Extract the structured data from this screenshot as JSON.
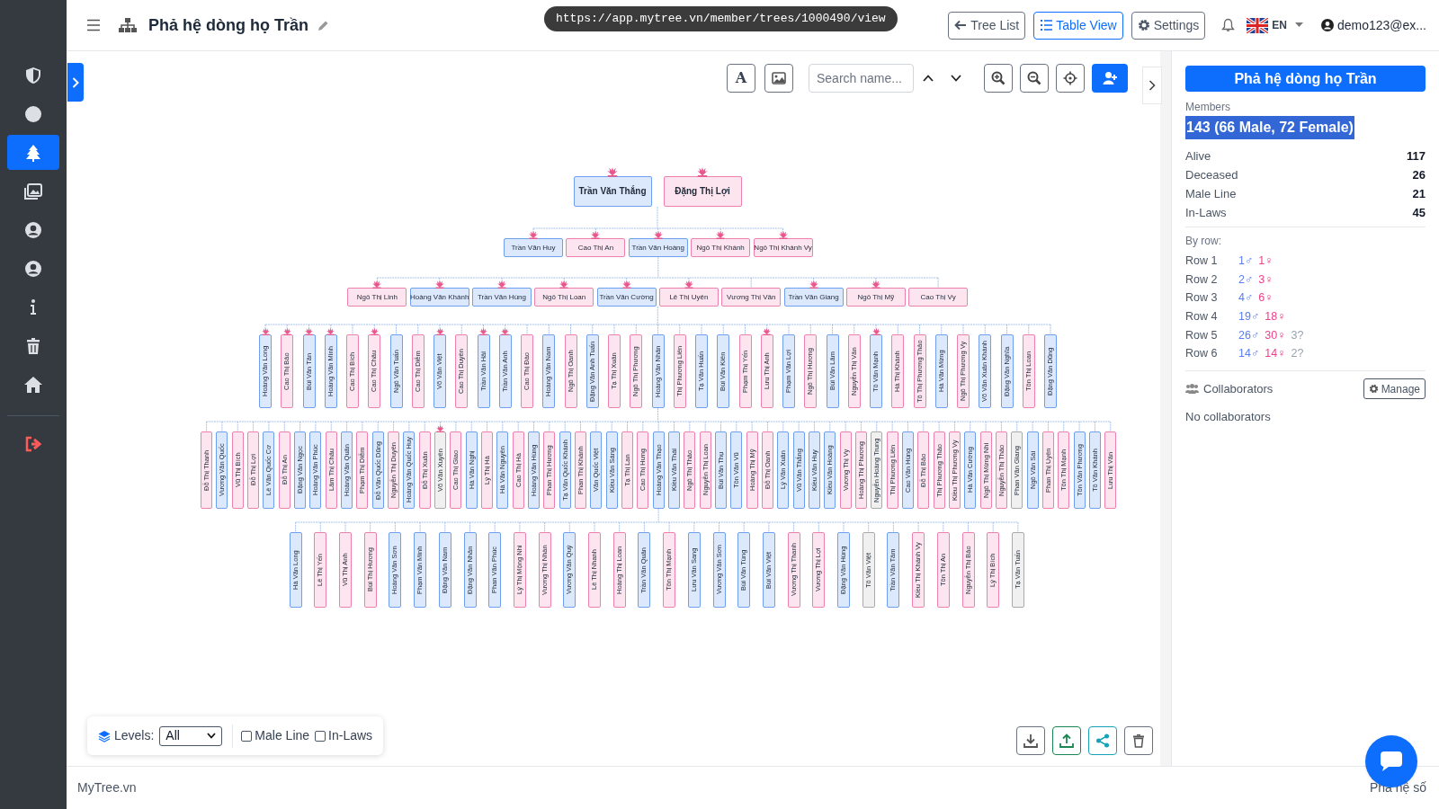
{
  "header": {
    "title": "Phả hệ dòng họ Trần",
    "url": "https://app.mytree.vn/member/trees/1000490/view",
    "buttons": [
      {
        "label": "Tree List",
        "selected": false
      },
      {
        "label": "Table View",
        "selected": true
      },
      {
        "label": "Settings",
        "selected": false
      }
    ],
    "language": "EN",
    "user": "demo123@ex..."
  },
  "sidebar": {
    "items": [
      {
        "selected": false
      },
      {
        "selected": false
      },
      {
        "selected": true
      },
      {
        "selected": false
      },
      {
        "selected": false
      },
      {
        "selected": false
      },
      {
        "selected": false
      },
      {
        "selected": false
      },
      {
        "selected": false
      },
      {
        "selected": false
      }
    ]
  },
  "canvas_toolbar": {
    "text_button": "A",
    "search": {
      "placeholder": "Search name..."
    }
  },
  "tree": {
    "rows": [
      {
        "nodes": [
          {
            "name": "Trần Văn Thắng",
            "kind": "male",
            "crowned": true
          },
          {
            "name": "Đặng Thị Lợi",
            "kind": "female",
            "crowned": true
          }
        ]
      },
      {
        "nodes": [
          {
            "name": "Trần Văn Huy",
            "kind": "male",
            "crowned": true
          },
          {
            "name": "Cao Thị An",
            "kind": "female",
            "crowned": true
          },
          {
            "name": "Trần Văn Hoàng",
            "kind": "male",
            "crowned": true
          },
          {
            "name": "Ngô Thị Khánh",
            "kind": "female",
            "crowned": true
          },
          {
            "name": "Ngô Thị Khánh Vy",
            "kind": "female",
            "crowned": true
          }
        ]
      },
      {
        "nodes": [
          {
            "name": "Ngô Thị Linh",
            "kind": "female",
            "crowned": true
          },
          {
            "name": "Hoàng Văn Khánh",
            "kind": "male",
            "crowned": true
          },
          {
            "name": "Trần Văn Hùng",
            "kind": "male",
            "crowned": true
          },
          {
            "name": "Ngô Thị Loan",
            "kind": "female",
            "crowned": true
          },
          {
            "name": "Trần Văn Cường",
            "kind": "male",
            "crowned": true
          },
          {
            "name": "Lê Thị Uyên",
            "kind": "female",
            "crowned": true
          },
          {
            "name": "Vương Thị Vân",
            "kind": "female",
            "crowned": false
          },
          {
            "name": "Trần Văn Giang",
            "kind": "male",
            "crowned": true
          },
          {
            "name": "Ngô Thị Mỹ",
            "kind": "female",
            "crowned": true
          },
          {
            "name": "Cao Thị Vy",
            "kind": "female",
            "crowned": false
          }
        ]
      },
      {
        "nodes": [
          {
            "name": "Hoàng Văn Long",
            "kind": "male",
            "crowned": true
          },
          {
            "name": "Cao Thị Bảo",
            "kind": "female",
            "crowned": true
          },
          {
            "name": "Bùi Văn Tân",
            "kind": "male",
            "crowned": true
          },
          {
            "name": "Hoàng Văn Minh",
            "kind": "male",
            "crowned": true
          },
          {
            "name": "Cao Thị Bích",
            "kind": "female",
            "crowned": false
          },
          {
            "name": "Cao Thị Châu",
            "kind": "female",
            "crowned": true
          },
          {
            "name": "Ngô Văn Tuấn",
            "kind": "male",
            "crowned": false
          },
          {
            "name": "Cao Thị Diễm",
            "kind": "female",
            "crowned": false
          },
          {
            "name": "Võ Văn Việt",
            "kind": "male",
            "crowned": true
          },
          {
            "name": "Cao Thị Duyên",
            "kind": "female",
            "crowned": false
          },
          {
            "name": "Trần Văn Hải",
            "kind": "male",
            "crowned": true
          },
          {
            "name": "Trần Văn Anh",
            "kind": "male",
            "crowned": true
          },
          {
            "name": "Cao Thị Đào",
            "kind": "female",
            "crowned": false
          },
          {
            "name": "Hoàng Văn Nam",
            "kind": "male",
            "crowned": false
          },
          {
            "name": "Ngô Thị Oanh",
            "kind": "female",
            "crowned": false
          },
          {
            "name": "Đặng Văn Anh Tuấn",
            "kind": "male",
            "crowned": false
          },
          {
            "name": "Tạ Thị Xuân",
            "kind": "female",
            "crowned": false
          },
          {
            "name": "Ngô Thị Phương",
            "kind": "female",
            "crowned": false
          },
          {
            "name": "Hoàng Văn Nhân",
            "kind": "male",
            "crowned": false
          },
          {
            "name": "Thị Phương Liên",
            "kind": "female",
            "crowned": false
          },
          {
            "name": "Tạ Văn Huấn",
            "kind": "male",
            "crowned": false
          },
          {
            "name": "Bùi Văn Kiên",
            "kind": "male",
            "crowned": false
          },
          {
            "name": "Phạm Thị Yến",
            "kind": "female",
            "crowned": false
          },
          {
            "name": "Lưu Thị Anh",
            "kind": "female",
            "crowned": true
          },
          {
            "name": "Phạm Văn Lợi",
            "kind": "male",
            "crowned": false
          },
          {
            "name": "Ngô Thị Hương",
            "kind": "female",
            "crowned": false
          },
          {
            "name": "Bùi Văn Lâm",
            "kind": "male",
            "crowned": false
          },
          {
            "name": "Nguyễn Thị Vân",
            "kind": "female",
            "crowned": false
          },
          {
            "name": "Tô Văn Mạnh",
            "kind": "male",
            "crowned": true
          },
          {
            "name": "Hà Thị Khánh",
            "kind": "female",
            "crowned": false
          },
          {
            "name": "Tô Thị Phương Thảo",
            "kind": "female",
            "crowned": false
          },
          {
            "name": "Hà Văn Mừng",
            "kind": "male",
            "crowned": false
          },
          {
            "name": "Ngô Thị Phương Vy",
            "kind": "female",
            "crowned": false
          },
          {
            "name": "Võ Văn Xuân Khánh",
            "kind": "male",
            "crowned": false
          },
          {
            "name": "Đặng Văn Nghĩa",
            "kind": "male",
            "crowned": false
          },
          {
            "name": "Tôn Thị Loan",
            "kind": "female",
            "crowned": false
          },
          {
            "name": "Đặng Văn Dũng",
            "kind": "male",
            "crowned": false
          }
        ]
      },
      {
        "nodes": [
          {
            "name": "Đỗ Thị Thanh",
            "kind": "female",
            "crowned": false
          },
          {
            "name": "Vương Văn Quốc",
            "kind": "male",
            "crowned": false
          },
          {
            "name": "Vũ Thị Bích",
            "kind": "female",
            "crowned": false
          },
          {
            "name": "Đỗ Thị Lợi",
            "kind": "female",
            "crowned": false
          },
          {
            "name": "Lê Văn Quốc Cơ",
            "kind": "male",
            "crowned": false
          },
          {
            "name": "Đỗ Thị An",
            "kind": "female",
            "crowned": false
          },
          {
            "name": "Đặng Văn Ngọc",
            "kind": "male",
            "crowned": false
          },
          {
            "name": "Hoàng Văn Phúc",
            "kind": "male",
            "crowned": false
          },
          {
            "name": "Lâm Thị Châu",
            "kind": "female",
            "crowned": false
          },
          {
            "name": "Hoàng Văn Quân",
            "kind": "male",
            "crowned": false
          },
          {
            "name": "Phạm Thị Diễm",
            "kind": "female",
            "crowned": false
          },
          {
            "name": "Đỗ Văn Quốc Dũng",
            "kind": "male",
            "crowned": false
          },
          {
            "name": "Nguyễn Thị Duyên",
            "kind": "female",
            "crowned": false
          },
          {
            "name": "Hoàng Văn Quốc Huy",
            "kind": "male",
            "crowned": false
          },
          {
            "name": "Đỗ Thị Xuân",
            "kind": "female",
            "crowned": false
          },
          {
            "name": "Võ Văn Xuyên",
            "kind": "unknown",
            "crowned": true
          },
          {
            "name": "Cao Thị Giao",
            "kind": "female",
            "crowned": false
          },
          {
            "name": "Hà Văn Nghị",
            "kind": "male",
            "crowned": false
          },
          {
            "name": "Lý Thị Hà",
            "kind": "female",
            "crowned": false
          },
          {
            "name": "Hà Văn Nguyên",
            "kind": "male",
            "crowned": false
          },
          {
            "name": "Cao Thị Hà",
            "kind": "female",
            "crowned": false
          },
          {
            "name": "Hoàng Văn Hùng",
            "kind": "male",
            "crowned": false
          },
          {
            "name": "Phan Thị Hương",
            "kind": "female",
            "crowned": false
          },
          {
            "name": "Tạ Văn Quốc Khánh",
            "kind": "male",
            "crowned": false
          },
          {
            "name": "Phan Thị Khánh",
            "kind": "female",
            "crowned": false
          },
          {
            "name": "Văn Quốc Việt",
            "kind": "male",
            "crowned": false
          },
          {
            "name": "Kiều Văn Sáng",
            "kind": "male",
            "crowned": false
          },
          {
            "name": "Tạ Thị Lan",
            "kind": "female",
            "crowned": false
          },
          {
            "name": "Cao Thị Hưng",
            "kind": "female",
            "crowned": false
          },
          {
            "name": "Hoàng Văn Thạo",
            "kind": "male",
            "crowned": false
          },
          {
            "name": "Kiều Văn Thái",
            "kind": "male",
            "crowned": false
          },
          {
            "name": "Ngô Thị Thảo",
            "kind": "female",
            "crowned": false
          },
          {
            "name": "Nguyễn Thị Loan",
            "kind": "female",
            "crowned": false
          },
          {
            "name": "Bùi Văn Thụ",
            "kind": "male",
            "crowned": false
          },
          {
            "name": "Tôn Văn Vũ",
            "kind": "male",
            "crowned": false
          },
          {
            "name": "Hoàng Thị Mỹ",
            "kind": "female",
            "crowned": false
          },
          {
            "name": "Đỗ Thị Oanh",
            "kind": "female",
            "crowned": false
          },
          {
            "name": "Lý Văn Xuân",
            "kind": "male",
            "crowned": false
          },
          {
            "name": "Vũ Văn Thắng",
            "kind": "male",
            "crowned": false
          },
          {
            "name": "Kiều Văn Huy",
            "kind": "male",
            "crowned": false
          },
          {
            "name": "Kiều Văn Hoàng",
            "kind": "male",
            "crowned": false
          },
          {
            "name": "Vương Thị Vy",
            "kind": "female",
            "crowned": false
          },
          {
            "name": "Hoàng Thị Phương",
            "kind": "female",
            "crowned": false
          },
          {
            "name": "Nguyễn Hoàng Trung",
            "kind": "unknown",
            "crowned": false
          },
          {
            "name": "Thị Phương Liên",
            "kind": "female",
            "crowned": false
          },
          {
            "name": "Cao Văn Hùng",
            "kind": "male",
            "crowned": false
          },
          {
            "name": "Đỗ Thị Bảo",
            "kind": "female",
            "crowned": false
          },
          {
            "name": "Thị Phương Thảo",
            "kind": "female",
            "crowned": false
          },
          {
            "name": "Kiều Thị Phương Vy",
            "kind": "female",
            "crowned": false
          },
          {
            "name": "Hà Văn Cường",
            "kind": "male",
            "crowned": false
          },
          {
            "name": "Ngô Thị Mừng Nhi",
            "kind": "female",
            "crowned": false
          },
          {
            "name": "Nguyễn Thị Thảo",
            "kind": "female",
            "crowned": false
          },
          {
            "name": "Phan Văn Giang",
            "kind": "unknown",
            "crowned": false
          },
          {
            "name": "Ngô Văn Sái",
            "kind": "male",
            "crowned": false
          },
          {
            "name": "Phan Thị Uyên",
            "kind": "female",
            "crowned": false
          },
          {
            "name": "Tôn Thị Mạnh",
            "kind": "female",
            "crowned": false
          },
          {
            "name": "Tôn Văn Phương",
            "kind": "male",
            "crowned": false
          },
          {
            "name": "Tô Văn Khánh",
            "kind": "male",
            "crowned": false
          },
          {
            "name": "Lưu Thị Vân",
            "kind": "female",
            "crowned": false
          }
        ]
      },
      {
        "nodes": [
          {
            "name": "Hà Văn Long",
            "kind": "male",
            "crowned": false
          },
          {
            "name": "Lê Thị Yến",
            "kind": "female",
            "crowned": false
          },
          {
            "name": "Vũ Thị Anh",
            "kind": "female",
            "crowned": false
          },
          {
            "name": "Bùi Thị Hương",
            "kind": "female",
            "crowned": false
          },
          {
            "name": "Hoàng Văn Sơn",
            "kind": "male",
            "crowned": false
          },
          {
            "name": "Phạm Văn Minh",
            "kind": "male",
            "crowned": false
          },
          {
            "name": "Đặng Văn Nam",
            "kind": "male",
            "crowned": false
          },
          {
            "name": "Đặng Văn Nhân",
            "kind": "male",
            "crowned": false
          },
          {
            "name": "Phan Văn Phúc",
            "kind": "male",
            "crowned": false
          },
          {
            "name": "Lý Thị Mộng Nhi",
            "kind": "female",
            "crowned": false
          },
          {
            "name": "Vương Thị Nhàn",
            "kind": "female",
            "crowned": false
          },
          {
            "name": "Vương Văn Quý",
            "kind": "male",
            "crowned": false
          },
          {
            "name": "Lê Thị Nhanh",
            "kind": "female",
            "crowned": false
          },
          {
            "name": "Hoàng Thị Loan",
            "kind": "female",
            "crowned": false
          },
          {
            "name": "Trần Văn Quân",
            "kind": "male",
            "crowned": false
          },
          {
            "name": "Tôn Thị Mạnh",
            "kind": "female",
            "crowned": false
          },
          {
            "name": "Lưu Văn Sang",
            "kind": "male",
            "crowned": false
          },
          {
            "name": "Vương Văn Sơn",
            "kind": "male",
            "crowned": false
          },
          {
            "name": "Bùi Văn Tùng",
            "kind": "male",
            "crowned": false
          },
          {
            "name": "Bùi Văn Việt",
            "kind": "male",
            "crowned": false
          },
          {
            "name": "Vương Thị Thanh",
            "kind": "female",
            "crowned": false
          },
          {
            "name": "Vương Thị Lợi",
            "kind": "female",
            "crowned": false
          },
          {
            "name": "Đặng Văn Hùng",
            "kind": "male",
            "crowned": false
          },
          {
            "name": "Tô Văn Việt",
            "kind": "unknown",
            "crowned": false
          },
          {
            "name": "Trần Văn Tâm",
            "kind": "male",
            "crowned": false
          },
          {
            "name": "Kiều Thị Khánh Vy",
            "kind": "female",
            "crowned": false
          },
          {
            "name": "Tôn Thị An",
            "kind": "female",
            "crowned": false
          },
          {
            "name": "Nguyễn Thị Bảo",
            "kind": "female",
            "crowned": false
          },
          {
            "name": "Lý Thị Bích",
            "kind": "female",
            "crowned": false
          },
          {
            "name": "Tạ Văn Tuấn",
            "kind": "unknown",
            "crowned": false
          }
        ]
      }
    ]
  },
  "filters": {
    "label": "Levels:",
    "level": "All",
    "male_line": {
      "label": "Male Line",
      "checked": false
    },
    "in_laws": {
      "label": "In-Laws",
      "checked": false
    }
  },
  "info_panel": {
    "title": "Phả hệ dòng họ Trần",
    "members_label": "Members",
    "members": "143 (66 Male, 72 Female)",
    "stats": [
      {
        "label": "Alive",
        "value": "117"
      },
      {
        "label": "Deceased",
        "value": "26"
      },
      {
        "label": "Male Line",
        "value": "21"
      },
      {
        "label": "In-Laws",
        "value": "45"
      }
    ],
    "by_row_label": "By row:",
    "by_row": [
      {
        "label": "Row 1",
        "male": "1♂",
        "female": "1♀"
      },
      {
        "label": "Row 2",
        "male": "2♂",
        "female": "3♀"
      },
      {
        "label": "Row 3",
        "male": "4♂",
        "female": "6♀"
      },
      {
        "label": "Row 4",
        "male": "19♂",
        "female": "18♀"
      },
      {
        "label": "Row 5",
        "male": "26♂",
        "female": "30♀",
        "unknown": "3?"
      },
      {
        "label": "Row 6",
        "male": "14♂",
        "female": "14♀",
        "unknown": "2?"
      }
    ],
    "collaborators_label": "Collaborators",
    "manage": "Manage",
    "collaborators_empty": "No collaborators"
  },
  "footer": {
    "brand": "MyTree.vn",
    "right": "Phả hệ số"
  }
}
